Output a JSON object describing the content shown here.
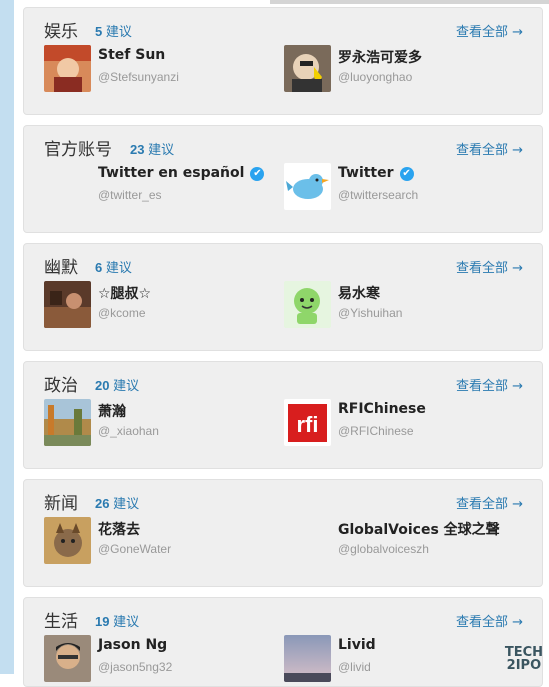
{
  "cards": [
    {
      "title": "娱乐",
      "count": "5",
      "count_label": "建议",
      "view_all": "查看全部 →",
      "users": [
        {
          "name": "Stef Sun",
          "handle": "@Stefsunyanzi",
          "verified": false
        },
        {
          "name": "罗永浩可爱多",
          "handle": "@luoyonghao",
          "verified": false
        }
      ]
    },
    {
      "title": "官方账号",
      "count": "23",
      "count_label": "建议",
      "view_all": "查看全部 →",
      "users": [
        {
          "name": "Twitter en español",
          "handle": "@twitter_es",
          "verified": true
        },
        {
          "name": "Twitter",
          "handle": "@twittersearch",
          "verified": true
        }
      ]
    },
    {
      "title": "幽默",
      "count": "6",
      "count_label": "建议",
      "view_all": "查看全部 →",
      "users": [
        {
          "name": "☆腿叔☆",
          "handle": "@kcome",
          "verified": false
        },
        {
          "name": "易水寒",
          "handle": "@Yishuihan",
          "verified": false
        }
      ]
    },
    {
      "title": "政治",
      "count": "20",
      "count_label": "建议",
      "view_all": "查看全部 →",
      "users": [
        {
          "name": "萧瀚",
          "handle": "@_xiaohan",
          "verified": false
        },
        {
          "name": "RFIChinese",
          "handle": "@RFIChinese",
          "verified": false
        }
      ]
    },
    {
      "title": "新闻",
      "count": "26",
      "count_label": "建议",
      "view_all": "查看全部 →",
      "users": [
        {
          "name": "花落去",
          "handle": "@GoneWater",
          "verified": false
        },
        {
          "name": "GlobalVoices 全球之聲",
          "handle": "@globalvoiceszh",
          "verified": false
        }
      ]
    },
    {
      "title": "生活",
      "count": "19",
      "count_label": "建议",
      "view_all": "查看全部 →",
      "users": [
        {
          "name": "Jason Ng",
          "handle": "@jason5ng32",
          "verified": false
        },
        {
          "name": "Livid",
          "handle": "@livid",
          "verified": false
        }
      ]
    }
  ],
  "avatar_logos": {
    "rfi": "rfi"
  },
  "watermark": {
    "line1": "TECH",
    "line2": "2IPO"
  },
  "colors": {
    "link": "#2a7ab0",
    "card_bg": "#efefef",
    "verified": "#2aa3ef",
    "left_bar": "#c3def0"
  }
}
